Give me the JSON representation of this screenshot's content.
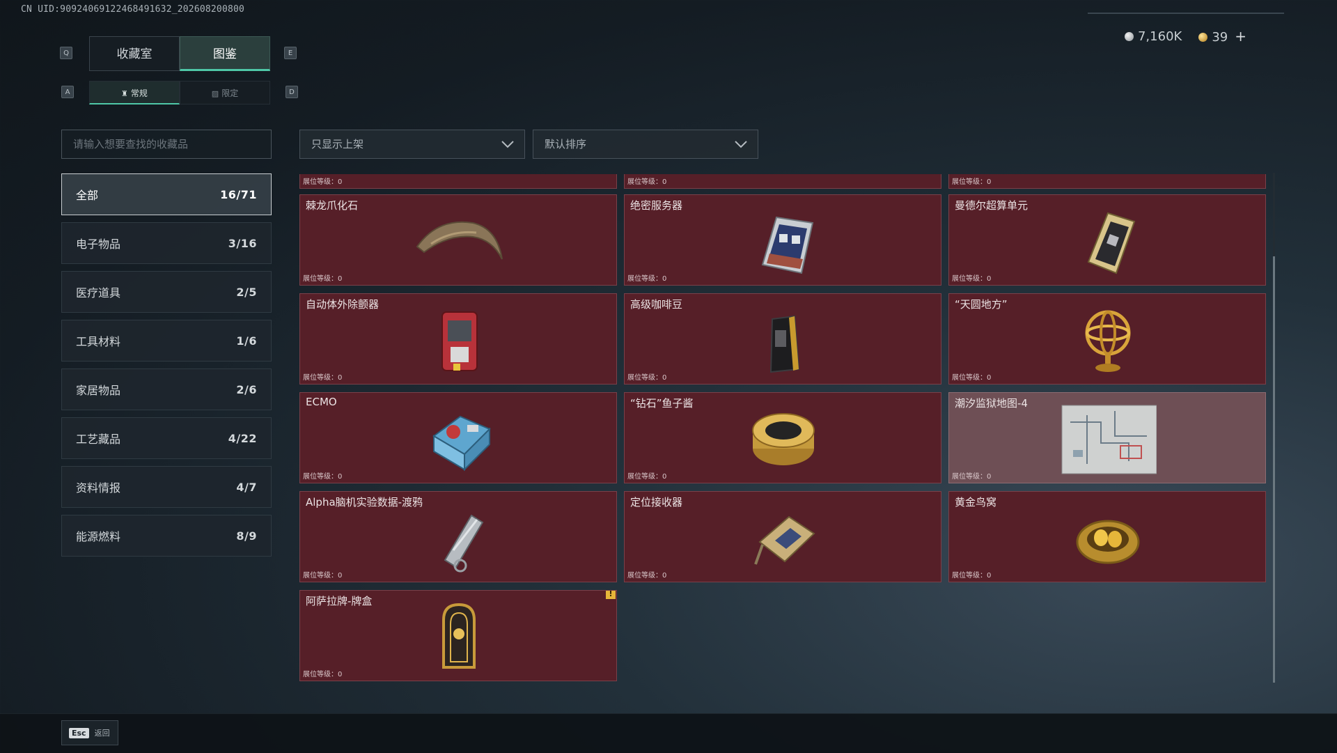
{
  "uid": "CN UID:9092406912246849163​2_202608200800",
  "keys": {
    "q": "Q",
    "e": "E",
    "a": "A",
    "d": "D"
  },
  "tabs": [
    "收藏室",
    "图鉴"
  ],
  "subtabs": [
    "常规",
    "限定"
  ],
  "currency": {
    "silver": "7,160K",
    "gold": "39",
    "plus": "+"
  },
  "search_placeholder": "请输入想要查找的收藏品",
  "filters": {
    "display": "只显示上架",
    "sort": "默认排序"
  },
  "categories": [
    {
      "label": "全部",
      "count": "16/71"
    },
    {
      "label": "电子物品",
      "count": "3/16"
    },
    {
      "label": "医疗道具",
      "count": "2/5"
    },
    {
      "label": "工具材料",
      "count": "1/6"
    },
    {
      "label": "家居物品",
      "count": "2/6"
    },
    {
      "label": "工艺藏品",
      "count": "4/22"
    },
    {
      "label": "资料情报",
      "count": "4/7"
    },
    {
      "label": "能源燃料",
      "count": "8/9"
    }
  ],
  "level_label": "展位等级：0",
  "items": [
    {
      "name": "",
      "icon": "partial-card"
    },
    {
      "name": "",
      "icon": "partial-card"
    },
    {
      "name": "",
      "icon": "partial-card"
    },
    {
      "name": "棘龙爪化石",
      "icon": "claw-fossil-icon"
    },
    {
      "name": "绝密服务器",
      "icon": "server-icon"
    },
    {
      "name": "曼德尔超算单元",
      "icon": "compute-unit-icon"
    },
    {
      "name": "自动体外除颤器",
      "icon": "defibrillator-icon"
    },
    {
      "name": "高级咖啡豆",
      "icon": "coffee-bag-icon"
    },
    {
      "name": "“天圆地方”",
      "icon": "armillary-sphere-icon"
    },
    {
      "name": "ECMO",
      "icon": "ecmo-machine-icon"
    },
    {
      "name": "“钻石”鱼子酱",
      "icon": "caviar-tin-icon"
    },
    {
      "name": "潮汐监狱地图-4",
      "icon": "map-icon"
    },
    {
      "name": "Alpha脑机实验数据-渡鸦",
      "icon": "data-canister-icon"
    },
    {
      "name": "定位接收器",
      "icon": "receiver-icon"
    },
    {
      "name": "黄金鸟窝",
      "icon": "golden-nest-icon"
    },
    {
      "name": "阿萨拉牌-牌盒",
      "icon": "card-box-icon",
      "warn": "!"
    }
  ],
  "footer": {
    "esc": "Esc",
    "back": "返回"
  }
}
